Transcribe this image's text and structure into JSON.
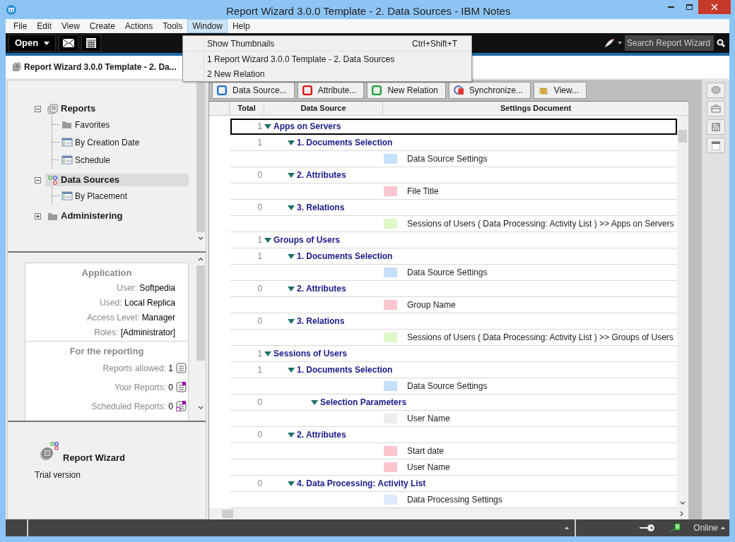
{
  "window": {
    "title": "Report Wizard 3.0.0 Template - 2. Data Sources - IBM Notes"
  },
  "menu_bar": [
    {
      "label": "File",
      "selected": false
    },
    {
      "label": "Edit",
      "selected": false
    },
    {
      "label": "View",
      "selected": false
    },
    {
      "label": "Create",
      "selected": false
    },
    {
      "label": "Actions",
      "selected": false
    },
    {
      "label": "Tools",
      "selected": false
    },
    {
      "label": "Window",
      "selected": true
    },
    {
      "label": "Help",
      "selected": false
    }
  ],
  "window_menu": [
    {
      "label": "Show Thumbnails",
      "shortcut": "Ctrl+Shift+T"
    },
    {
      "label": "1 Report Wizard 3.0.0 Template - 2. Data Sources"
    },
    {
      "label": "2 New Relation"
    }
  ],
  "toolbar": {
    "open_button": "Open",
    "search": {
      "placeholder": "Search Report Wizard"
    }
  },
  "tab": {
    "label": "Report Wizard 3.0.0 Template - 2. Da..."
  },
  "navigator": [
    {
      "label": "Reports",
      "kind": "reports",
      "expanded": true,
      "selected": false,
      "children": [
        {
          "label": "Favorites",
          "kind": "folder",
          "selected": false
        },
        {
          "label": "By Creation Date",
          "kind": "view",
          "selected": false
        },
        {
          "label": "Schedule",
          "kind": "view",
          "selected": false
        }
      ]
    },
    {
      "label": "Data Sources",
      "kind": "datasources",
      "expanded": true,
      "selected": true,
      "children": [
        {
          "label": "By Placement",
          "kind": "view",
          "selected": false
        }
      ]
    },
    {
      "label": "Administering",
      "kind": "folder",
      "expanded": false,
      "selected": false
    }
  ],
  "info": {
    "application": {
      "heading": "Application",
      "fields": [
        {
          "label": "User:",
          "value": "Softpedia"
        },
        {
          "label": "Used:",
          "value": "Local Replica"
        },
        {
          "label": "Access Level:",
          "value": "Manager"
        },
        {
          "label": "Roles:",
          "value": "[Administrator]"
        }
      ]
    },
    "reporting": {
      "heading": "For the reporting",
      "fields": [
        {
          "label": "Reports allowed:",
          "value": "1",
          "kind": "list"
        },
        {
          "label": "Your Reports:",
          "value": "0",
          "kind": "new"
        },
        {
          "label": "Scheduled Reports:",
          "value": "0",
          "kind": "scheduled"
        }
      ]
    }
  },
  "about": {
    "title": "Report Wizard",
    "subtitle": "Trial version"
  },
  "view_actions": [
    {
      "label": "Data Source...",
      "kind": "source"
    },
    {
      "label": "Attribute...",
      "kind": "attribute"
    },
    {
      "label": "New Relation",
      "kind": "relation"
    },
    {
      "label": "Synchronize...",
      "kind": "sync"
    },
    {
      "label": "View...",
      "kind": "view"
    }
  ],
  "table": {
    "columns": [
      "Total",
      "Data Source",
      "Settings Document"
    ],
    "rows": [
      {
        "kind": "group",
        "total": "1",
        "label": "Apps on Servers",
        "expanded": true,
        "selected": true,
        "children": [
          {
            "kind": "group",
            "total": "1",
            "label": "1. Documents Selection",
            "expanded": true,
            "selected": false,
            "children": [
              {
                "kind": "doc",
                "label": "Data Source Settings",
                "color": "#c4e0fa",
                "selected": false
              }
            ]
          },
          {
            "kind": "group",
            "total": "0",
            "label": "2. Attributes",
            "expanded": true,
            "selected": false,
            "children": [
              {
                "kind": "doc",
                "label": "File Title",
                "color": "#fbc5d0",
                "selected": false
              }
            ]
          },
          {
            "kind": "group",
            "total": "0",
            "label": "3. Relations",
            "expanded": true,
            "selected": false,
            "children": [
              {
                "kind": "doc",
                "label": "Sessions of Users ( Data Processing: Activity List ) >> Apps on Servers",
                "color": "#def8c8",
                "selected": false
              }
            ]
          }
        ]
      },
      {
        "kind": "group",
        "total": "1",
        "label": "Groups of Users",
        "expanded": true,
        "selected": false,
        "children": [
          {
            "kind": "group",
            "total": "1",
            "label": "1. Documents Selection",
            "expanded": true,
            "selected": false,
            "children": [
              {
                "kind": "doc",
                "label": "Data Source Settings",
                "color": "#c4e0fa",
                "selected": false
              }
            ]
          },
          {
            "kind": "group",
            "total": "0",
            "label": "2. Attributes",
            "expanded": true,
            "selected": false,
            "children": [
              {
                "kind": "doc",
                "label": "Group Name",
                "color": "#fbc5d0",
                "selected": false
              }
            ]
          },
          {
            "kind": "group",
            "total": "0",
            "label": "3. Relations",
            "expanded": true,
            "selected": false,
            "children": [
              {
                "kind": "doc",
                "label": "Sessions of Users ( Data Processing: Activity List ) >> Groups of Users",
                "color": "#def8c8",
                "selected": false
              }
            ]
          }
        ]
      },
      {
        "kind": "group",
        "total": "1",
        "label": "Sessions of Users",
        "expanded": true,
        "selected": false,
        "children": [
          {
            "kind": "group",
            "total": "1",
            "label": "1. Documents Selection",
            "expanded": true,
            "selected": false,
            "children": [
              {
                "kind": "doc",
                "label": "Data Source Settings",
                "color": "#c4e0fa",
                "selected": false
              },
              {
                "kind": "group",
                "total": "0",
                "label": "Selection Parameters",
                "expanded": true,
                "selected": false,
                "children": [
                  {
                    "kind": "doc",
                    "label": "User Name",
                    "color": "#ededed",
                    "selected": false
                  }
                ]
              }
            ]
          },
          {
            "kind": "group",
            "total": "0",
            "label": "2. Attributes",
            "expanded": true,
            "selected": false,
            "children": [
              {
                "kind": "doc",
                "label": "Start date",
                "color": "#fbc5d0",
                "selected": false
              },
              {
                "kind": "doc",
                "label": "User Name",
                "color": "#fbc5d0",
                "selected": false
              }
            ]
          },
          {
            "kind": "group",
            "total": "0",
            "label": "4. Data Processing: Activity List",
            "expanded": true,
            "selected": false,
            "children": [
              {
                "kind": "doc",
                "label": "Data Processing Settings",
                "color": "#dcecfb",
                "selected": false
              }
            ]
          }
        ]
      }
    ]
  },
  "status_bar": {
    "status": "Online"
  }
}
